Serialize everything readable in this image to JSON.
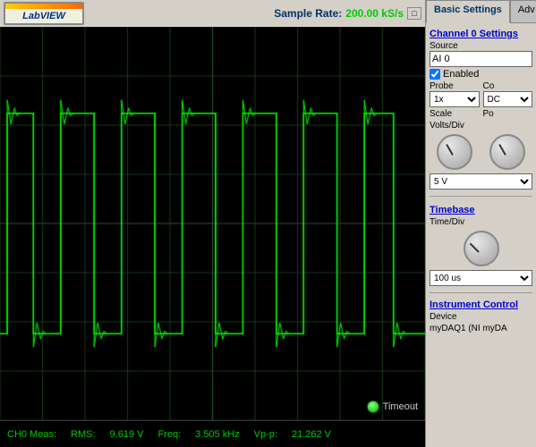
{
  "toolbar": {
    "logo_text": "LabVIEW",
    "sample_rate_label": "Sample Rate:",
    "sample_rate_value": "200.00 kS/s",
    "restore_icon": "□"
  },
  "measurements": {
    "ch0_label": "CH0 Meas:",
    "rms_label": "RMS:",
    "rms_value": "9.619 V",
    "freq_label": "Freq:",
    "freq_value": "3.505 kHz",
    "vpp_label": "Vp-p:",
    "vpp_value": "21.262 V"
  },
  "timeout": {
    "label": "Timeout"
  },
  "tabs": {
    "basic": "Basic Settings",
    "adv": "Adv"
  },
  "channel_settings": {
    "title": "Channel 0 Settings",
    "source_label": "Source",
    "source_value": "AI 0",
    "enabled_label": "Enabled",
    "probe_label": "Probe",
    "probe_col_label": "Co",
    "probe_value": "1x",
    "coupling_value": "DC",
    "scale_label": "Scale",
    "volts_div_label": "Volts/Div",
    "position_label": "Po",
    "volt_value": "5 V"
  },
  "timebase": {
    "title": "Timebase",
    "label": "Time/Div",
    "value": "100 us"
  },
  "instrument_control": {
    "title": "Instrument Control",
    "device_label": "Device",
    "device_value": "myDAQ1 (NI myDA"
  }
}
